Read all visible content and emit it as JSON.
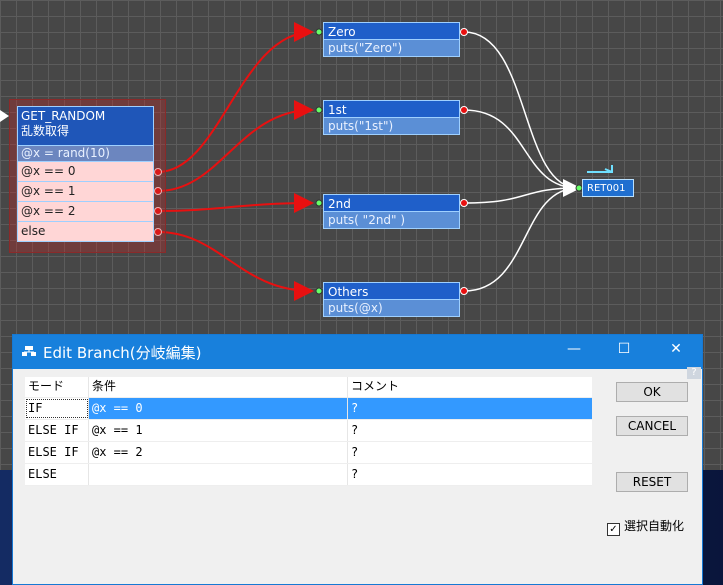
{
  "colors": {
    "node_head": "#1f5fc9",
    "node_sub": "#5b8fd6",
    "cond_bg": "#ffd6d6",
    "wire_red": "#e81010",
    "wire_white": "#ffffff",
    "selection": "#3399ff",
    "titlebar": "#1880dc"
  },
  "canvas": {
    "random_node": {
      "title_line1": "GET_RANDOM",
      "title_line2": "乱数取得",
      "expr": "@x = rand(10)",
      "conditions": [
        "@x == 0",
        "@x == 1",
        "@x == 2",
        "else"
      ]
    },
    "targets": [
      {
        "label": "Zero",
        "code": "puts(\"Zero\")"
      },
      {
        "label": "1st",
        "code": "puts(\"1st\")"
      },
      {
        "label": "2nd",
        "code": "puts( \"2nd\" )"
      },
      {
        "label": "Others",
        "code": "puts(@x)"
      }
    ],
    "return_node": {
      "label": "RET001"
    }
  },
  "dialog": {
    "title": "Edit Branch(分岐編集)",
    "window_buttons": {
      "minimize": "—",
      "maximize": "☐",
      "close": "✕"
    },
    "help": "?",
    "table": {
      "headers": [
        "モード",
        "条件",
        "コメント"
      ],
      "rows": [
        {
          "mode": "IF",
          "condition": "@x == 0",
          "comment": "?",
          "selected": true
        },
        {
          "mode": "ELSE IF",
          "condition": "@x == 1",
          "comment": "?",
          "selected": false
        },
        {
          "mode": "ELSE IF",
          "condition": "@x == 2",
          "comment": "?",
          "selected": false
        },
        {
          "mode": "ELSE",
          "condition": "",
          "comment": "?",
          "selected": false
        }
      ]
    },
    "buttons": {
      "ok": "OK",
      "cancel": "CANCEL",
      "reset": "RESET"
    },
    "auto_select": {
      "label": "選択自動化",
      "checked": true
    }
  }
}
